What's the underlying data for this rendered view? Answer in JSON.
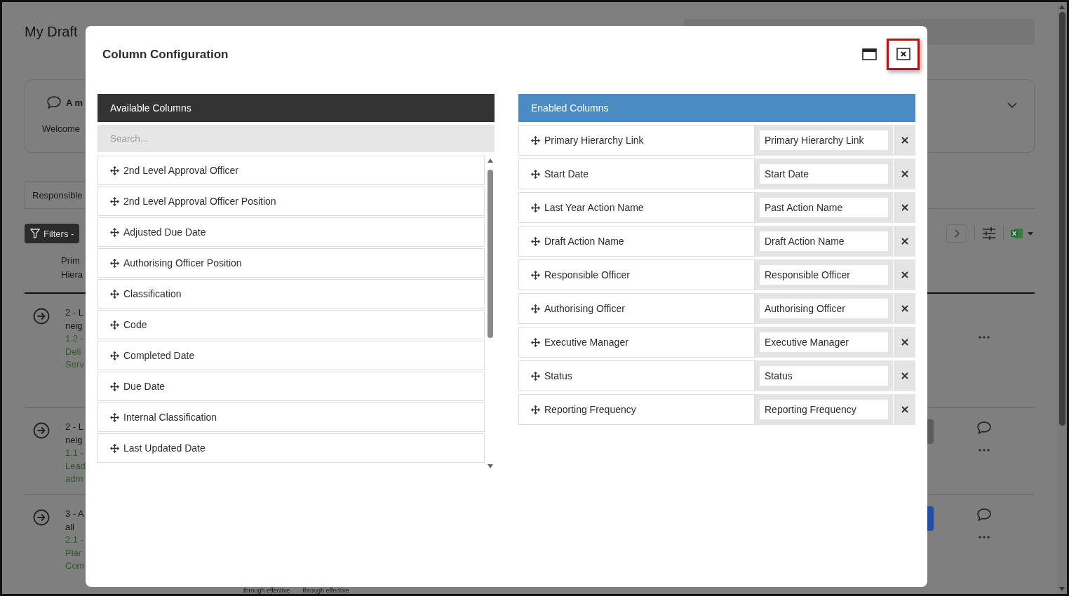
{
  "page": {
    "title": "My Draft",
    "announcement": {
      "title": "A m",
      "text": "Welcome"
    },
    "tabs": [
      {
        "label": "Responsible",
        "selected": true
      }
    ],
    "filters_button": "Filters -",
    "table": {
      "header_lines": [
        "Prim",
        "Hiera"
      ],
      "rows": [
        {
          "lines": [
            "2 - L",
            "neig"
          ],
          "links": [
            "1.2 -",
            "Deli",
            "Serv"
          ],
          "kind": "plain",
          "comment": false
        },
        {
          "lines": [
            "2 - L",
            "neig"
          ],
          "links": [
            "1.1 -",
            "Lead",
            "adm"
          ],
          "kind": "secondary",
          "comment": true
        },
        {
          "lines": [
            "3 - A",
            "all"
          ],
          "links": [
            "2.1 -",
            "Plar",
            "Com"
          ],
          "kind": "primary",
          "comment": true
        }
      ],
      "cut_texts": [
        "through effective",
        "through effective"
      ]
    }
  },
  "modal": {
    "title": "Column Configuration",
    "close_highlighted": true,
    "available": {
      "title": "Available Columns",
      "search_placeholder": "Search...",
      "items": [
        "2nd Level Approval Officer",
        "2nd Level Approval Officer Position",
        "Adjusted Due Date",
        "Authorising Officer Position",
        "Classification",
        "Code",
        "Completed Date",
        "Due Date",
        "Internal Classification",
        "Last Updated Date"
      ]
    },
    "enabled": {
      "title": "Enabled Columns",
      "items": [
        {
          "name": "Primary Hierarchy Link",
          "label": "Primary Hierarchy Link"
        },
        {
          "name": "Start Date",
          "label": "Start Date"
        },
        {
          "name": "Last Year Action Name",
          "label": "Past Action Name"
        },
        {
          "name": "Draft Action Name",
          "label": "Draft Action Name"
        },
        {
          "name": "Responsible Officer",
          "label": "Responsible Officer"
        },
        {
          "name": "Authorising Officer",
          "label": "Authorising Officer"
        },
        {
          "name": "Executive Manager",
          "label": "Executive Manager"
        },
        {
          "name": "Status",
          "label": "Status"
        },
        {
          "name": "Reporting Frequency",
          "label": "Reporting Frequency"
        }
      ]
    }
  }
}
